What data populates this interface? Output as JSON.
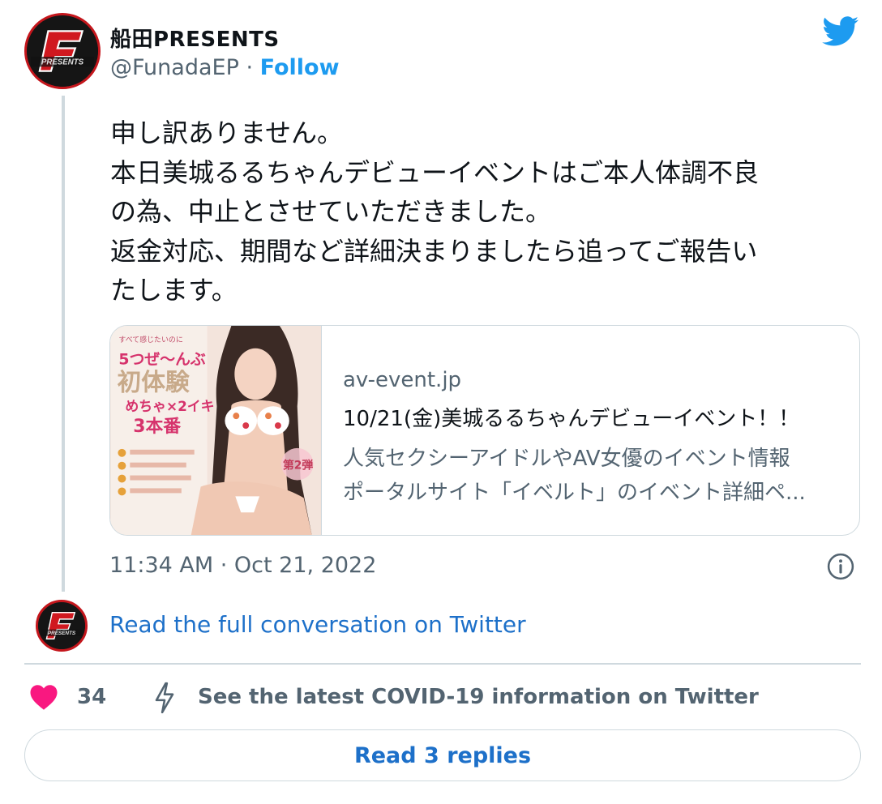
{
  "author": {
    "display_name": "船田PRESENTS",
    "handle": "@FunadaEP",
    "separator": " · ",
    "follow_label": "Follow",
    "avatar_icon": "funada-presents-logo",
    "avatar_logo_text": "PRESENTS"
  },
  "brand_icon": "twitter-bird-icon",
  "tweet": {
    "lines": [
      "申し訳ありません。",
      "本日美城るるちゃんデビューイベントはご本人体調不良",
      "の為、中止とさせていただきました。",
      "返金対応、期間など詳細決まりましたら追ってご報告い",
      "たします。"
    ]
  },
  "card": {
    "domain": "av-event.jp",
    "title": "10/21(金)美城るるちゃんデビューイベント！！",
    "description_lines": [
      "人気セクシーアイドルやAV女優のイベント情報",
      "ポータルサイト「イベルト」のイベント詳細ペ..."
    ],
    "image_text": {
      "headline": "5つぜ〜んぶ",
      "main": "初体験",
      "sub": "めちゃ×2イキ",
      "count": "3本番",
      "badge": "第2弾"
    }
  },
  "timestamp": "11:34 AM · Oct 21, 2022",
  "read_conversation": "Read the full conversation on Twitter",
  "actions": {
    "like_count": "34",
    "covid_label": "See the latest COVID-19 information on Twitter",
    "replies_label": "Read 3 replies"
  },
  "colors": {
    "link_blue": "#1d9bf0",
    "heart": "#f91880",
    "border": "#cfd9de",
    "muted_text": "#536471"
  }
}
